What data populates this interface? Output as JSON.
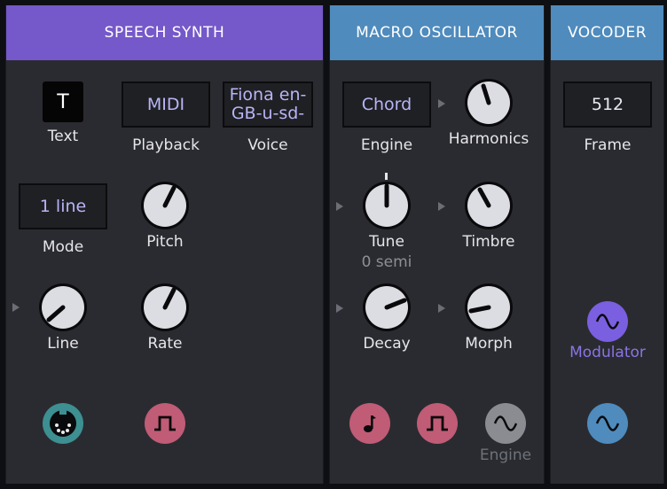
{
  "panels": {
    "speech_synth": {
      "title": "SPEECH SYNTH",
      "text_button": "T",
      "text_label": "Text",
      "playback_value": "MIDI",
      "playback_label": "Playback",
      "voice_value": "Fiona en-GB-u-sd-",
      "voice_label": "Voice",
      "mode_value": "1 line",
      "mode_label": "Mode",
      "pitch_label": "Pitch",
      "line_label": "Line",
      "rate_label": "Rate"
    },
    "macro_oscillator": {
      "title": "MACRO OSCILLATOR",
      "engine_value": "Chord",
      "engine_label": "Engine",
      "harmonics_label": "Harmonics",
      "tune_label": "Tune",
      "tune_value": "0 semi",
      "timbre_label": "Timbre",
      "decay_label": "Decay",
      "morph_label": "Morph",
      "engine_port_label": "Engine"
    },
    "vocoder": {
      "title": "VOCODER",
      "frame_value": "512",
      "frame_label": "Frame",
      "modulator_label": "Modulator"
    }
  },
  "icons": {
    "midi_port": "midi-port-icon",
    "gate_port": "square-wave-icon",
    "note_port": "note-icon",
    "sine_port": "sine-wave-icon"
  },
  "colors": {
    "speech_header": "#7558c9",
    "oscillator_header": "#4f8bbd",
    "midi_port": "#3d8f91",
    "gate_port": "#c05c76",
    "engine_port": "#8b8c92",
    "modulator_port": "#7a5fe0",
    "output_port": "#4f8bbd",
    "value_text": "#b9b4f6"
  }
}
